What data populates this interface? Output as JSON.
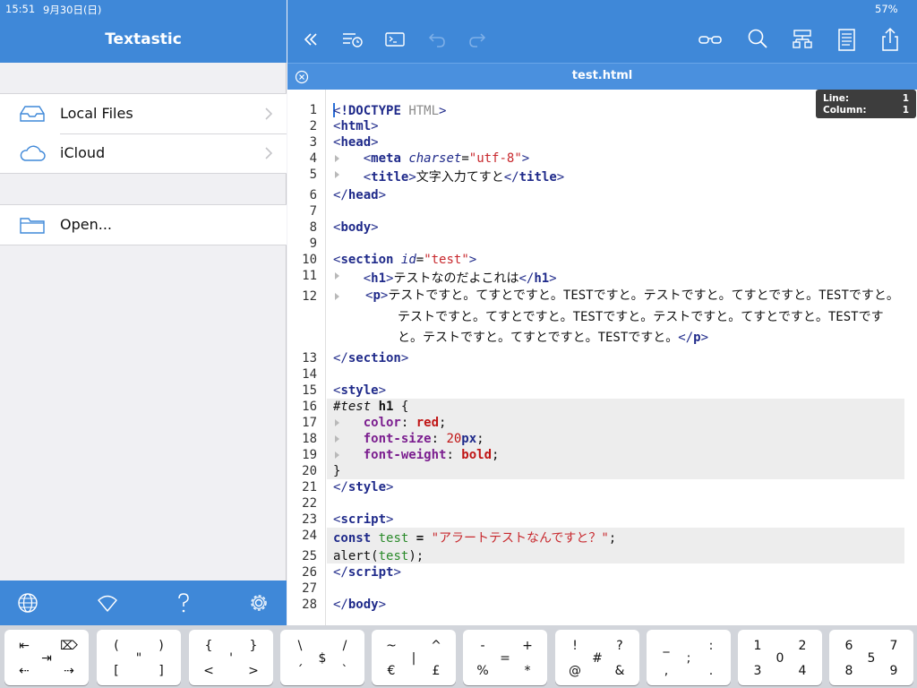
{
  "status": {
    "time": "15:51",
    "date": "9月30日(日)",
    "battery": "57%"
  },
  "sidebar": {
    "title": "Textastic",
    "items": [
      {
        "label": "Local Files",
        "icon": "inbox-tray-icon"
      },
      {
        "label": "iCloud",
        "icon": "cloud-icon"
      }
    ],
    "open": {
      "label": "Open...",
      "icon": "folder-icon"
    },
    "footer_icons": [
      "globe-icon",
      "wifi-icon",
      "help-icon",
      "gear-icon"
    ]
  },
  "toolbar": {
    "icons": [
      "collapse-icon",
      "history-icon",
      "terminal-icon",
      "undo-icon",
      "redo-icon",
      "preview-glasses-icon",
      "search-icon",
      "symbols-icon",
      "document-icon",
      "share-icon"
    ]
  },
  "tab": {
    "title": "test.html"
  },
  "position": {
    "line_label": "Line:",
    "line": "1",
    "column_label": "Column:",
    "column": "1"
  },
  "editor": {
    "line_numbers": [
      "1",
      "2",
      "3",
      "4",
      "5",
      "6",
      "7",
      "8",
      "9",
      "10",
      "11",
      "12",
      "13",
      "14",
      "15",
      "16",
      "17",
      "18",
      "19",
      "20",
      "21",
      "22",
      "23",
      "24",
      "25",
      "26",
      "27",
      "28"
    ],
    "doctype": "HTML",
    "meta_charset": "\"utf-8\"",
    "title_text": "文字入力てすと",
    "section_id": "\"test\"",
    "h1_text": "テストなのだよこれは",
    "p_text": "テストですと。てすとですと。TESTですと。テストですと。てすとですと。TESTですと。テストですと。てすとですと。TESTですと。テストですと。てすとですと。TESTですと。テストですと。てすとですと。TESTですと。",
    "css_selector_id": "#test",
    "css_selector_tag": "h1",
    "css_color_prop": "color",
    "css_color_val": "red",
    "css_fs_prop": "font-size",
    "css_fs_num": "20",
    "css_fs_unit": "px",
    "css_fw_prop": "font-weight",
    "css_fw_val": "bold",
    "js_const": "const",
    "js_var": "test",
    "js_string": "\"アラートテストなんですと？\"",
    "js_alert": "alert",
    "js_arg": "test"
  },
  "keyboard": {
    "keys": [
      {
        "top_left": "⇤",
        "top_right": "⌦",
        "mid": "⇥",
        "bottom_left": "⇠",
        "bottom_right": "⇢"
      },
      {
        "top_left": "(",
        "top_right": ")",
        "mid": "\"",
        "bottom_left": "[",
        "bottom_right": "]"
      },
      {
        "top_left": "{",
        "top_right": "}",
        "mid": "'",
        "bottom_left": "<",
        "bottom_right": ">"
      },
      {
        "top_left": "\\",
        "top_right": "/",
        "mid": "$",
        "bottom_left": "´",
        "bottom_right": "`"
      },
      {
        "top_left": "~",
        "top_right": "^",
        "mid": "|",
        "bottom_left": "€",
        "bottom_right": "£"
      },
      {
        "top_left": "-",
        "top_right": "+",
        "mid": "=",
        "bottom_left": "%",
        "bottom_right": "*"
      },
      {
        "top_left": "!",
        "top_right": "?",
        "mid": "#",
        "bottom_left": "@",
        "bottom_right": "&"
      },
      {
        "top_left": "_",
        "top_right": ":",
        "mid": ";",
        "bottom_left": ",",
        "bottom_right": "."
      },
      {
        "top_left": "1",
        "top_right": "2",
        "mid": "0",
        "bottom_left": "3",
        "bottom_right": "4"
      },
      {
        "top_left": "6",
        "top_right": "7",
        "mid": "5",
        "bottom_left": "8",
        "bottom_right": "9"
      }
    ]
  }
}
